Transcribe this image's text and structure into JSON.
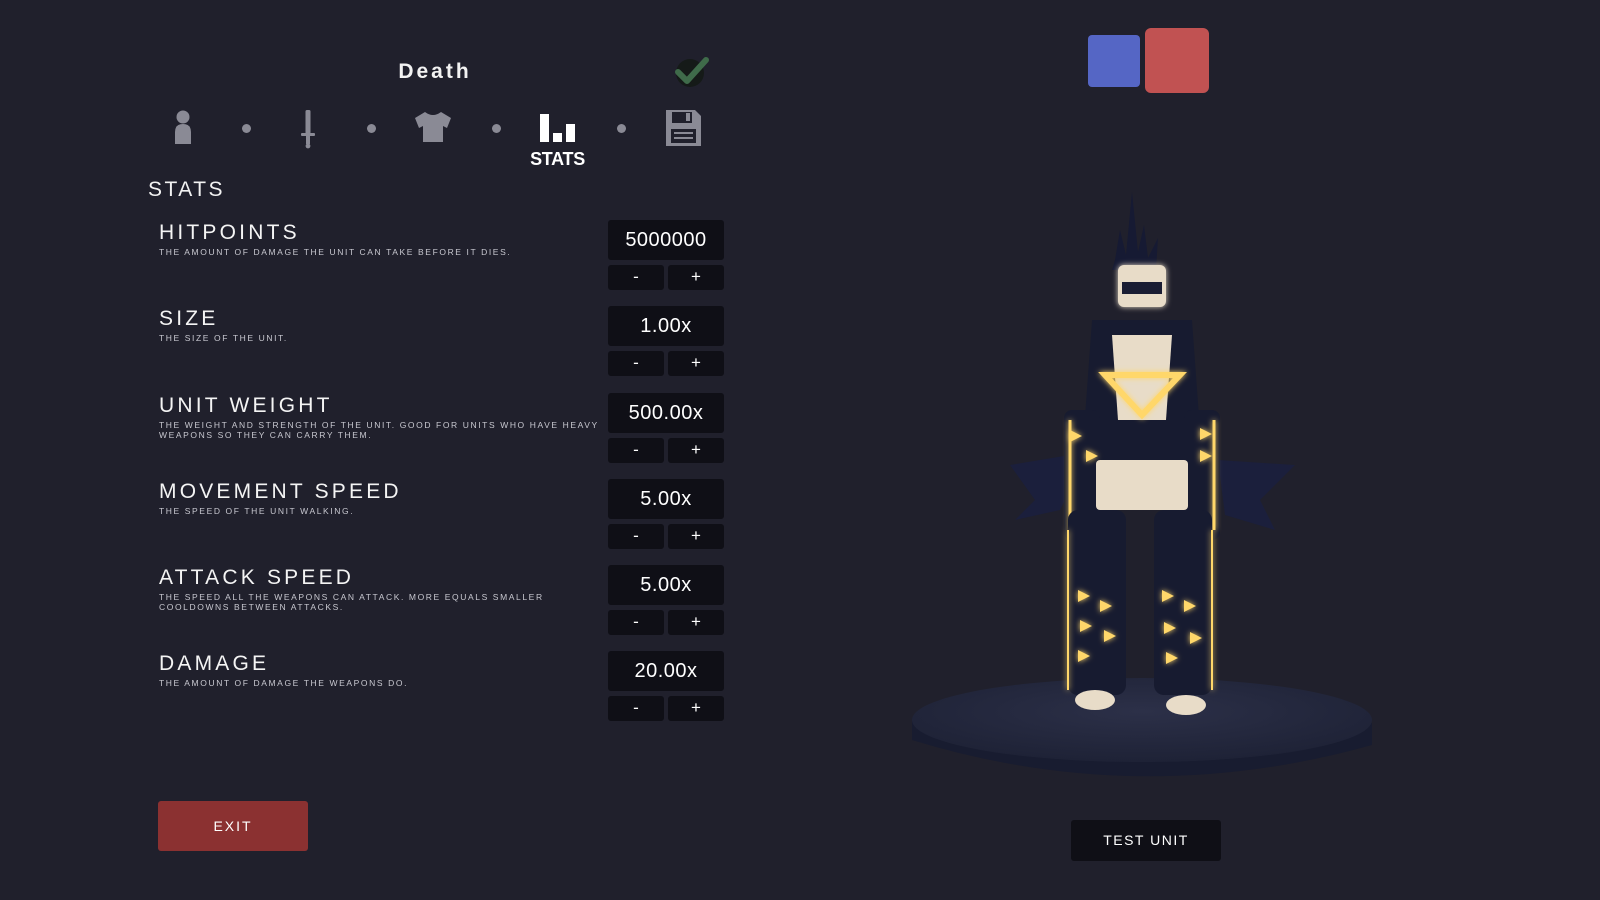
{
  "unit": {
    "name": "Death"
  },
  "icons": {
    "confirm": "check-icon",
    "steps": [
      "person-icon",
      "sword-icon",
      "shirt-icon",
      "stats-icon",
      "save-icon"
    ]
  },
  "nav": {
    "active_label": "STATS"
  },
  "section_title": "STATS",
  "stats": [
    {
      "name": "HITPOINTS",
      "description": "THE AMOUNT OF DAMAGE THE UNIT CAN TAKE BEFORE IT DIES.",
      "value": "5000000",
      "minus": "-",
      "plus": "+"
    },
    {
      "name": "SIZE",
      "description": "THE SIZE OF THE UNIT.",
      "value": "1.00x",
      "minus": "-",
      "plus": "+"
    },
    {
      "name": "UNIT WEIGHT",
      "description": "THE WEIGHT AND STRENGTH OF THE UNIT. GOOD FOR UNITS WHO HAVE HEAVY WEAPONS SO THEY CAN CARRY THEM.",
      "value": "500.00x",
      "minus": "-",
      "plus": "+"
    },
    {
      "name": "MOVEMENT SPEED",
      "description": "THE SPEED OF THE UNIT WALKING.",
      "value": "5.00x",
      "minus": "-",
      "plus": "+"
    },
    {
      "name": "ATTACK SPEED",
      "description": "THE SPEED ALL THE WEAPONS CAN ATTACK. MORE EQUALS SMALLER COOLDOWNS BETWEEN ATTACKS.",
      "value": "5.00x",
      "minus": "-",
      "plus": "+"
    },
    {
      "name": "DAMAGE",
      "description": "THE AMOUNT OF DAMAGE THE WEAPONS DO.",
      "value": "20.00x",
      "minus": "-",
      "plus": "+"
    }
  ],
  "buttons": {
    "exit": "EXIT",
    "test": "TEST UNIT"
  },
  "colors": {
    "background": "#20202c",
    "team_blue": "#5566c5",
    "team_red": "#c15252",
    "exit": "#8b3131",
    "glow": "#ffd76a"
  }
}
